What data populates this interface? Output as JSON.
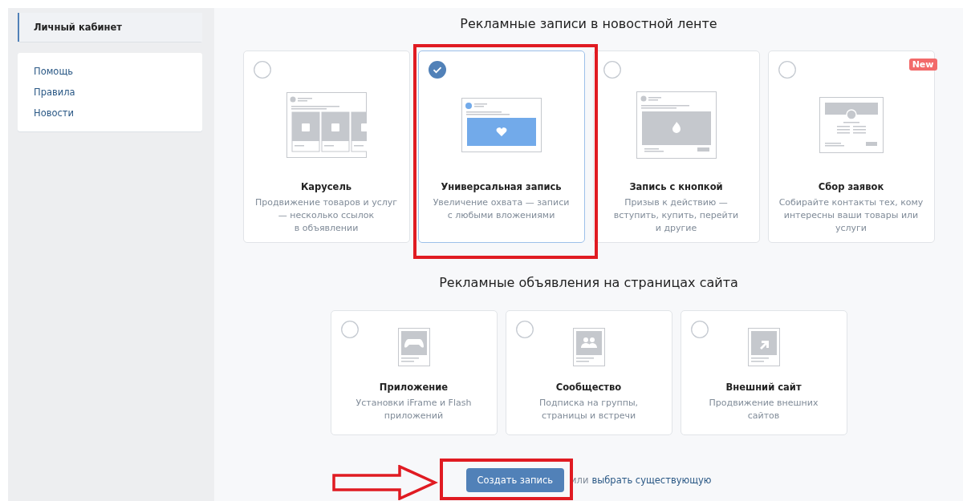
{
  "sidebar": {
    "menu": [
      {
        "label": "Личный кабинет",
        "selected": true
      }
    ],
    "links": [
      {
        "label": "Помощь"
      },
      {
        "label": "Правила"
      },
      {
        "label": "Новости"
      }
    ]
  },
  "sections": [
    {
      "title": "Рекламные записи в новостной ленте",
      "cards": [
        {
          "kind": "carousel",
          "title": "Карусель",
          "description": [
            "Продвижение товаров и услуг",
            "— несколько ссылок",
            "в объявлении"
          ],
          "selected": false
        },
        {
          "kind": "universal",
          "title": "Универсальная запись",
          "description": [
            "Увеличение охвата — записи",
            "с любыми вложениями"
          ],
          "selected": true
        },
        {
          "kind": "button",
          "title": "Запись с кнопкой",
          "description": [
            "Призыв к действию —",
            "вступить, купить, перейти",
            "и другие"
          ],
          "selected": false
        },
        {
          "kind": "leads",
          "title": "Сбор заявок",
          "description": [
            "Собирайте контакты тех, кому",
            "интересны ваши товары или",
            "услуги"
          ],
          "selected": false,
          "badge": "New"
        }
      ]
    },
    {
      "title": "Рекламные объявления на страницах сайта",
      "cards": [
        {
          "kind": "app",
          "title": "Приложение",
          "description": [
            "Установки iFrame и Flash",
            "приложений"
          ],
          "selected": false
        },
        {
          "kind": "community",
          "title": "Сообщество",
          "description": [
            "Подписка на группы,",
            "страницы и встречи"
          ],
          "selected": false
        },
        {
          "kind": "site",
          "title": "Внешний сайт",
          "description": [
            "Продвижение внешних",
            "сайтов"
          ],
          "selected": false
        }
      ]
    }
  ],
  "create_button": "Создать запись",
  "or_text": "или",
  "choose_link": "выбрать существующую"
}
